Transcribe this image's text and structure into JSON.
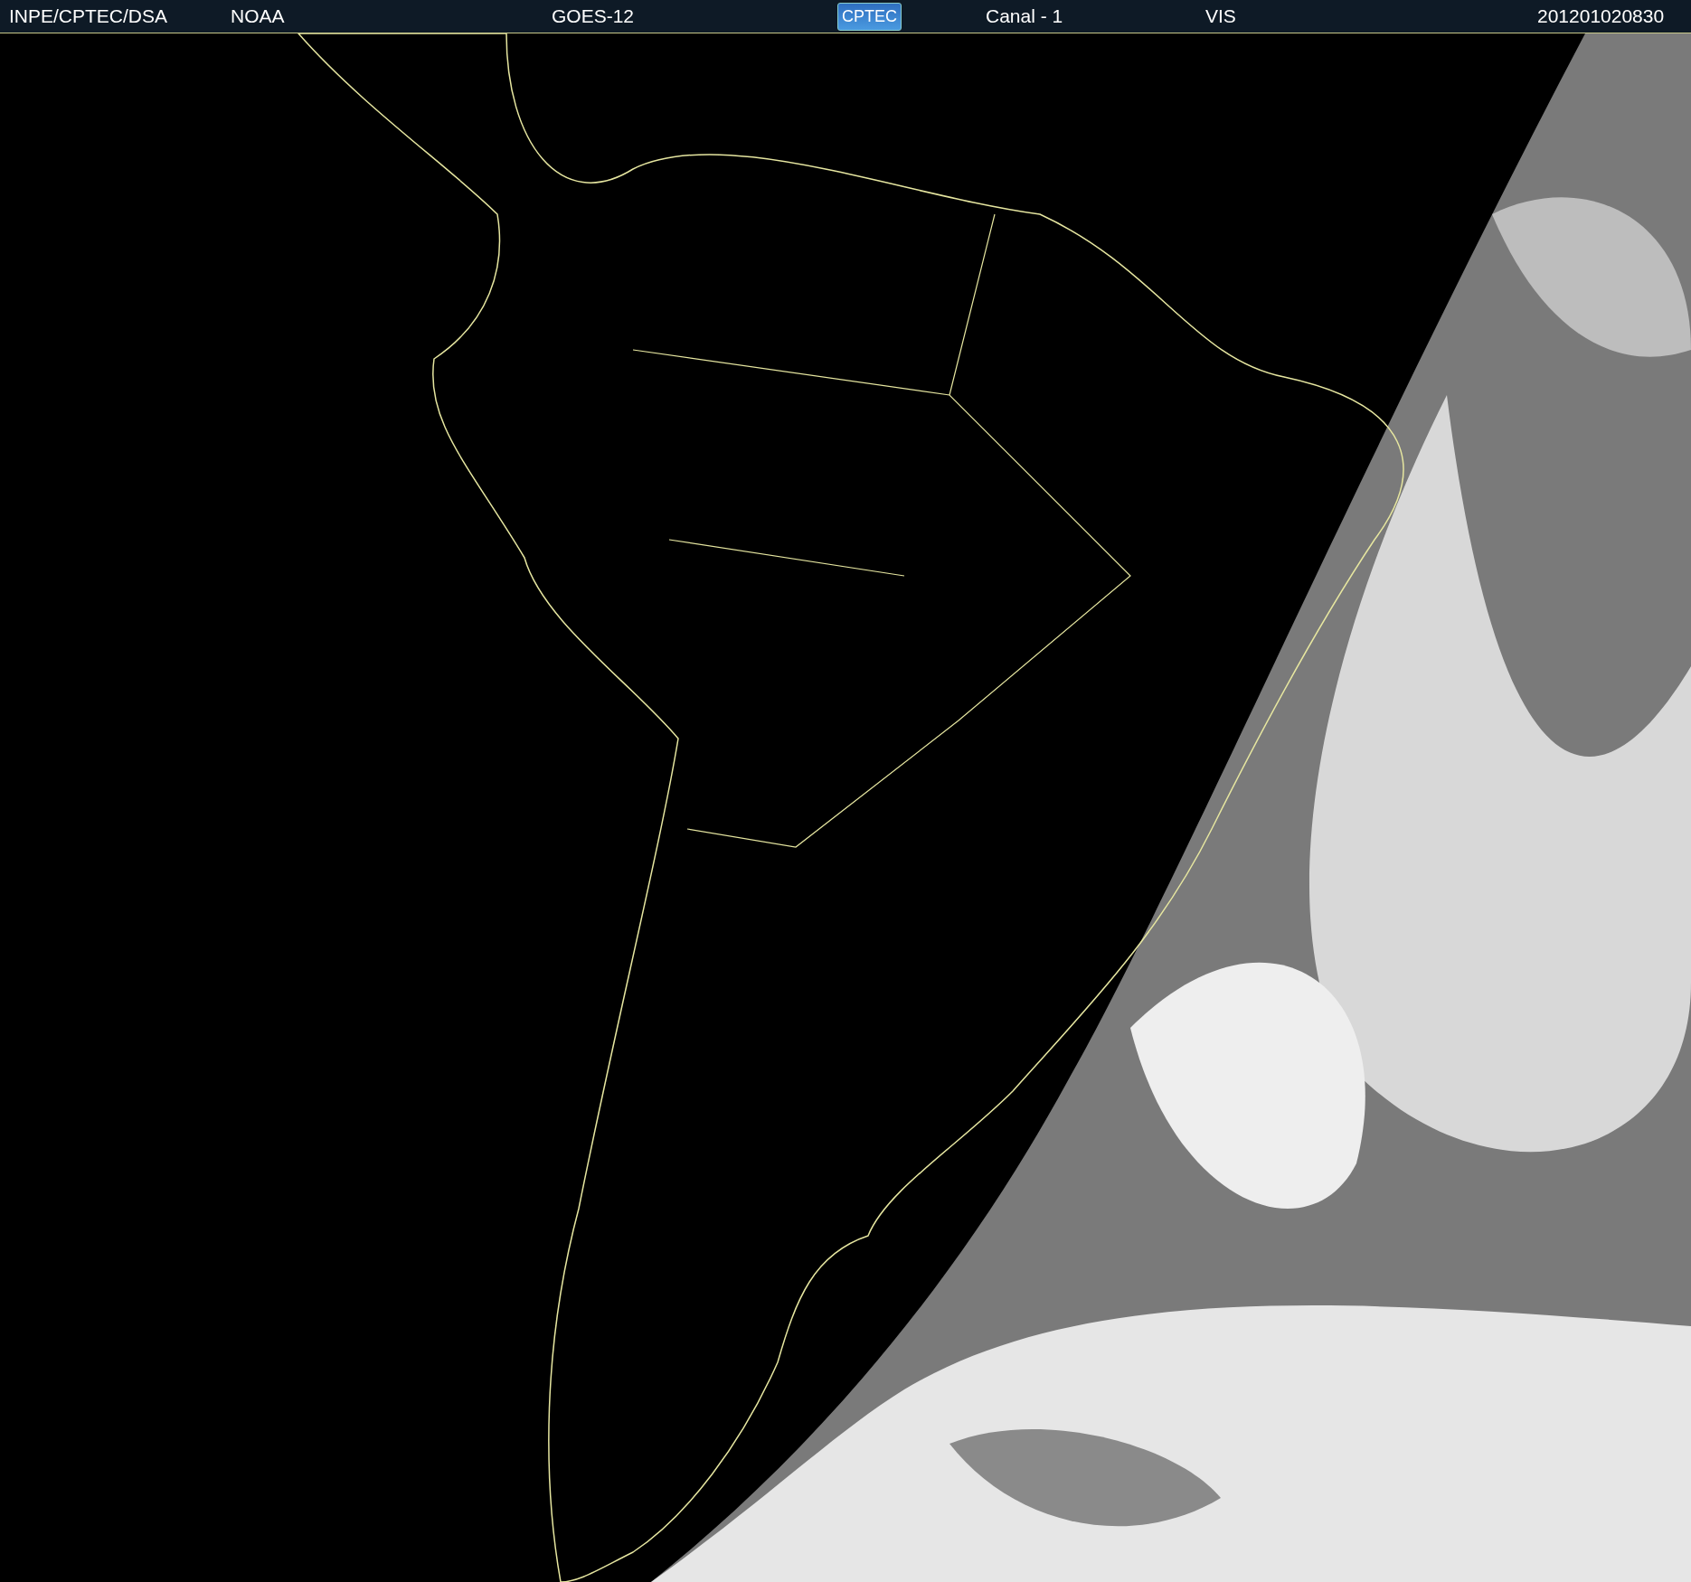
{
  "header": {
    "source": "INPE/CPTEC/DSA",
    "agency": "NOAA",
    "satellite": "GOES-12",
    "logo": "CPTEC",
    "channel": "Canal - 1",
    "band": "VIS",
    "timestamp": "201201020830"
  }
}
